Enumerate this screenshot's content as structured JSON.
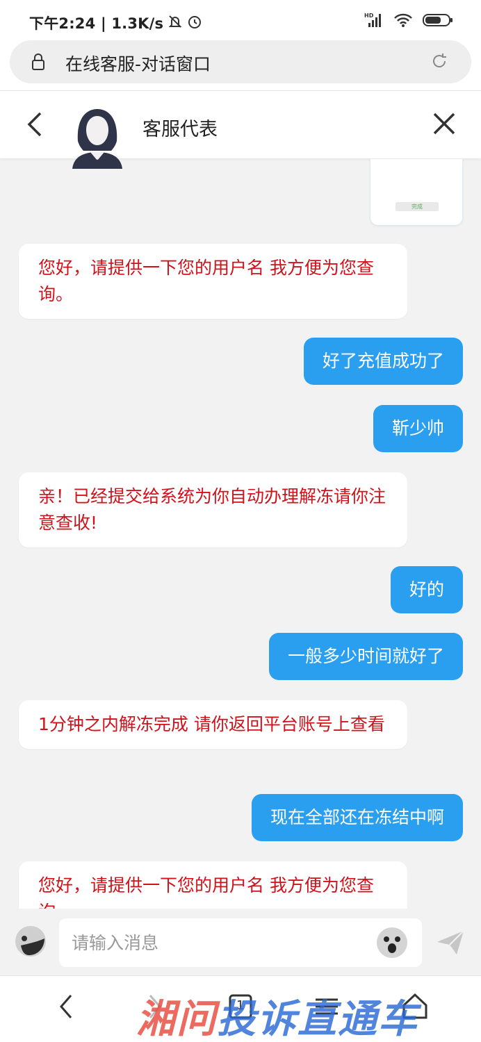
{
  "status_bar": {
    "time_speed": "下午2:24 | 1.3K/s",
    "icons": [
      "notification-muted-icon",
      "alarm-icon",
      "hd-signal-icon",
      "wifi-icon",
      "battery-icon"
    ]
  },
  "browser": {
    "page_title": "在线客服-对话窗口"
  },
  "chat_header": {
    "agent_name": "客服代表"
  },
  "partial_card": {
    "button_label": "完成"
  },
  "messages": [
    {
      "side": "in",
      "text": "您好，请提供一下您的用户名 我方便为您查询。"
    },
    {
      "side": "out",
      "text": "好了充值成功了"
    },
    {
      "side": "out",
      "text": "靳少帅"
    },
    {
      "side": "in",
      "text": "亲！已经提交给系统为你自动办理解冻请你注意查收!"
    },
    {
      "side": "out",
      "text": "好的"
    },
    {
      "side": "out",
      "text": "一般多少时间就好了"
    },
    {
      "side": "in",
      "text": "1分钟之内解冻完成 请你返回平台账号上查看"
    },
    {
      "side": "out",
      "text": "现在全部还在冻结中啊"
    },
    {
      "side": "in",
      "text": "您好，请提供一下您的用户名 我方便为您查询。"
    }
  ],
  "input": {
    "placeholder": "请输入消息",
    "value": ""
  },
  "nav": {
    "tab_count": "1"
  },
  "watermark": {
    "part1": "湘问",
    "part2": "投诉直通车"
  },
  "colors": {
    "incoming_text": "#d0121b",
    "outgoing_bubble": "#2a9ff0",
    "background": "#f2f2f2"
  }
}
